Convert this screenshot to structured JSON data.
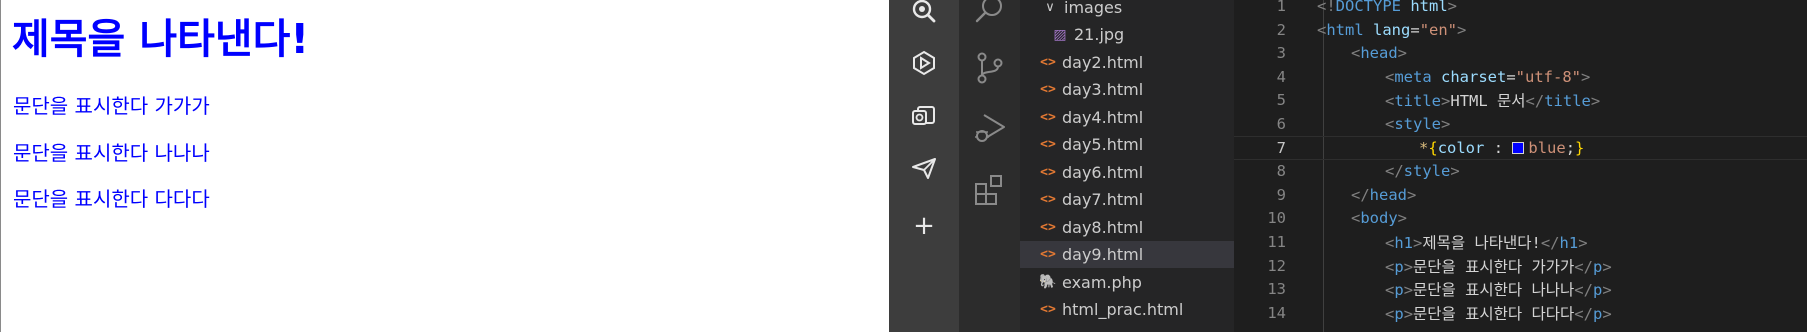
{
  "preview": {
    "heading": "제목을 나타낸다!",
    "paragraphs": [
      "문단을 표시한다 가가가",
      "문단을 표시한다 나나나",
      "문단을 표시한다 다다다"
    ],
    "text_color": "#0000ff"
  },
  "dock": {
    "icons": [
      "search-zoom-icon",
      "browser-icon",
      "mail-icon",
      "send-icon",
      "plus-icon"
    ],
    "plus": "+"
  },
  "activity_bar": {
    "icons": [
      "search-icon",
      "source-control-icon",
      "run-debug-icon",
      "extensions-icon"
    ]
  },
  "explorer": {
    "folder": {
      "name": "images",
      "chevron": "∨"
    },
    "files": [
      {
        "name": "21.jpg",
        "type": "image"
      },
      {
        "name": "day2.html",
        "type": "html"
      },
      {
        "name": "day3.html",
        "type": "html"
      },
      {
        "name": "day4.html",
        "type": "html"
      },
      {
        "name": "day5.html",
        "type": "html"
      },
      {
        "name": "day6.html",
        "type": "html"
      },
      {
        "name": "day7.html",
        "type": "html"
      },
      {
        "name": "day8.html",
        "type": "html"
      },
      {
        "name": "day9.html",
        "type": "html",
        "selected": true
      },
      {
        "name": "exam.php",
        "type": "php"
      },
      {
        "name": "html_prac.html",
        "type": "html"
      }
    ],
    "html_icon_glyph": "<>",
    "img_icon_glyph": "▨",
    "php_icon_glyph": "🐘"
  },
  "editor": {
    "current_line": 7,
    "lines": [
      {
        "n": "1",
        "t": [
          [
            "gray",
            "<!"
          ],
          [
            "tag",
            "DOCTYPE"
          ],
          [
            "attr",
            " html"
          ],
          [
            "gray",
            ">"
          ]
        ]
      },
      {
        "n": "2",
        "t": [
          [
            "gray",
            "<"
          ],
          [
            "tag",
            "html"
          ],
          [
            "attr",
            " lang"
          ],
          [
            "text",
            "="
          ],
          [
            "str",
            "\"en\""
          ],
          [
            "gray",
            ">"
          ]
        ]
      },
      {
        "n": "3",
        "t": [
          [
            "gray",
            "<"
          ],
          [
            "tag",
            "head"
          ],
          [
            "gray",
            ">"
          ]
        ]
      },
      {
        "n": "4",
        "t": [
          [
            "gray",
            "<"
          ],
          [
            "tag",
            "meta"
          ],
          [
            "attr",
            " charset"
          ],
          [
            "text",
            "="
          ],
          [
            "str",
            "\"utf-8\""
          ],
          [
            "gray",
            ">"
          ]
        ]
      },
      {
        "n": "5",
        "t": [
          [
            "gray",
            "<"
          ],
          [
            "tag",
            "title"
          ],
          [
            "gray",
            ">"
          ],
          [
            "text",
            "HTML 문서"
          ],
          [
            "gray",
            "</"
          ],
          [
            "tag",
            "title"
          ],
          [
            "gray",
            ">"
          ]
        ]
      },
      {
        "n": "6",
        "t": [
          [
            "gray",
            "<"
          ],
          [
            "tag",
            "style"
          ],
          [
            "gray",
            ">"
          ]
        ]
      },
      {
        "n": "7",
        "t": [
          [
            "sel",
            "*"
          ],
          [
            "brace",
            "{"
          ],
          [
            "attr",
            "color"
          ],
          [
            "text",
            " : "
          ],
          [
            "swatch",
            ""
          ],
          [
            "str",
            "blue"
          ],
          [
            "text",
            ";"
          ],
          [
            "brace",
            "}"
          ]
        ]
      },
      {
        "n": "8",
        "t": [
          [
            "gray",
            "</"
          ],
          [
            "tag",
            "style"
          ],
          [
            "gray",
            ">"
          ]
        ]
      },
      {
        "n": "9",
        "t": [
          [
            "gray",
            "</"
          ],
          [
            "tag",
            "head"
          ],
          [
            "gray",
            ">"
          ]
        ]
      },
      {
        "n": "10",
        "t": [
          [
            "gray",
            "<"
          ],
          [
            "tag",
            "body"
          ],
          [
            "gray",
            ">"
          ]
        ]
      },
      {
        "n": "11",
        "t": [
          [
            "gray",
            "<"
          ],
          [
            "tag",
            "h1"
          ],
          [
            "gray",
            ">"
          ],
          [
            "text",
            "제목을 나타낸다!"
          ],
          [
            "gray",
            "</"
          ],
          [
            "tag",
            "h1"
          ],
          [
            "gray",
            ">"
          ]
        ]
      },
      {
        "n": "12",
        "t": [
          [
            "gray",
            "<"
          ],
          [
            "tag",
            "p"
          ],
          [
            "gray",
            ">"
          ],
          [
            "text",
            "문단을 표시한다 가가가"
          ],
          [
            "gray",
            "</"
          ],
          [
            "tag",
            "p"
          ],
          [
            "gray",
            ">"
          ]
        ]
      },
      {
        "n": "13",
        "t": [
          [
            "gray",
            "<"
          ],
          [
            "tag",
            "p"
          ],
          [
            "gray",
            ">"
          ],
          [
            "text",
            "문단을 표시한다 나나나"
          ],
          [
            "gray",
            "</"
          ],
          [
            "tag",
            "p"
          ],
          [
            "gray",
            ">"
          ]
        ]
      },
      {
        "n": "14",
        "t": [
          [
            "gray",
            "<"
          ],
          [
            "tag",
            "p"
          ],
          [
            "gray",
            ">"
          ],
          [
            "text",
            "문단을 표시한다 다다다"
          ],
          [
            "gray",
            "</"
          ],
          [
            "tag",
            "p"
          ],
          [
            "gray",
            ">"
          ]
        ]
      }
    ]
  }
}
